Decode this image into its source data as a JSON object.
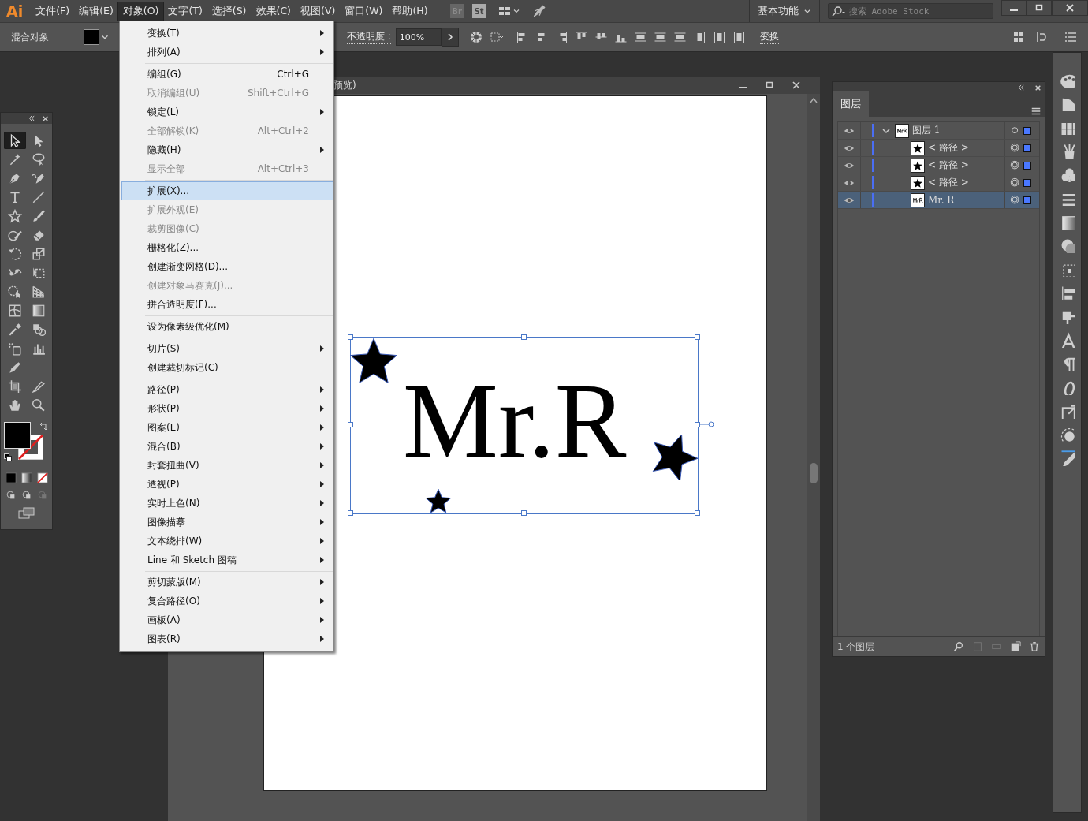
{
  "app": {
    "logo": "Ai",
    "menus": [
      {
        "label": "文件(F)",
        "selected": false
      },
      {
        "label": "编辑(E)",
        "selected": false
      },
      {
        "label": "对象(O)",
        "selected": true
      },
      {
        "label": "文字(T)",
        "selected": false
      },
      {
        "label": "选择(S)",
        "selected": false
      },
      {
        "label": "效果(C)",
        "selected": false
      },
      {
        "label": "视图(V)",
        "selected": false
      },
      {
        "label": "窗口(W)",
        "selected": false
      },
      {
        "label": "帮助(H)",
        "selected": false
      }
    ],
    "badges": [
      "Br",
      "St"
    ],
    "workspace": "基本功能",
    "search": {
      "placeholder": "搜索 Adobe Stock"
    }
  },
  "control_bar": {
    "selection_label": "混合对象",
    "opacity_label": "不透明度 :",
    "opacity_value": "100%",
    "transform_link": "变换"
  },
  "object_menu": [
    [
      {
        "label": "变换(T)",
        "submenu": true,
        "disabled": false,
        "selected": false
      },
      {
        "label": "排列(A)",
        "submenu": true,
        "disabled": false,
        "selected": false
      }
    ],
    [
      {
        "label": "编组(G)",
        "shortcut": "Ctrl+G",
        "submenu": false,
        "disabled": false,
        "selected": false
      },
      {
        "label": "取消编组(U)",
        "shortcut": "Shift+Ctrl+G",
        "submenu": false,
        "disabled": true,
        "selected": false
      },
      {
        "label": "锁定(L)",
        "submenu": true,
        "disabled": false,
        "selected": false
      },
      {
        "label": "全部解锁(K)",
        "shortcut": "Alt+Ctrl+2",
        "submenu": false,
        "disabled": true,
        "selected": false
      },
      {
        "label": "隐藏(H)",
        "submenu": true,
        "disabled": false,
        "selected": false
      },
      {
        "label": "显示全部",
        "shortcut": "Alt+Ctrl+3",
        "submenu": false,
        "disabled": true,
        "selected": false
      }
    ],
    [
      {
        "label": "扩展(X)...",
        "submenu": false,
        "disabled": false,
        "selected": true
      },
      {
        "label": "扩展外观(E)",
        "submenu": false,
        "disabled": true,
        "selected": false
      },
      {
        "label": "裁剪图像(C)",
        "submenu": false,
        "disabled": true,
        "selected": false
      },
      {
        "label": "栅格化(Z)...",
        "submenu": false,
        "disabled": false,
        "selected": false
      },
      {
        "label": "创建渐变网格(D)...",
        "submenu": false,
        "disabled": false,
        "selected": false
      },
      {
        "label": "创建对象马赛克(J)...",
        "submenu": false,
        "disabled": true,
        "selected": false
      },
      {
        "label": "拼合透明度(F)...",
        "submenu": false,
        "disabled": false,
        "selected": false
      }
    ],
    [
      {
        "label": "设为像素级优化(M)",
        "submenu": false,
        "disabled": false,
        "selected": false
      }
    ],
    [
      {
        "label": "切片(S)",
        "submenu": true,
        "disabled": false,
        "selected": false
      },
      {
        "label": "创建裁切标记(C)",
        "submenu": false,
        "disabled": false,
        "selected": false
      }
    ],
    [
      {
        "label": "路径(P)",
        "submenu": true,
        "disabled": false,
        "selected": false
      },
      {
        "label": "形状(P)",
        "submenu": true,
        "disabled": false,
        "selected": false
      },
      {
        "label": "图案(E)",
        "submenu": true,
        "disabled": false,
        "selected": false
      },
      {
        "label": "混合(B)",
        "submenu": true,
        "disabled": false,
        "selected": false
      },
      {
        "label": "封套扭曲(V)",
        "submenu": true,
        "disabled": false,
        "selected": false
      },
      {
        "label": "透视(P)",
        "submenu": true,
        "disabled": false,
        "selected": false
      },
      {
        "label": "实时上色(N)",
        "submenu": true,
        "disabled": false,
        "selected": false
      },
      {
        "label": "图像描摹",
        "submenu": true,
        "disabled": false,
        "selected": false
      },
      {
        "label": "文本绕排(W)",
        "submenu": true,
        "disabled": false,
        "selected": false
      },
      {
        "label": "Line 和 Sketch 图稿",
        "submenu": true,
        "disabled": false,
        "selected": false
      }
    ],
    [
      {
        "label": "剪切蒙版(M)",
        "submenu": true,
        "disabled": false,
        "selected": false
      },
      {
        "label": "复合路径(O)",
        "submenu": true,
        "disabled": false,
        "selected": false
      },
      {
        "label": "画板(A)",
        "submenu": true,
        "disabled": false,
        "selected": false
      },
      {
        "label": "图表(R)",
        "submenu": true,
        "disabled": false,
        "selected": false
      }
    ]
  ],
  "tools": [
    {
      "kind": "selection",
      "selected": true
    },
    {
      "kind": "direct",
      "selected": false
    },
    {
      "kind": "wand",
      "selected": false
    },
    {
      "kind": "lasso",
      "selected": false
    },
    {
      "kind": "pen",
      "selected": false
    },
    {
      "kind": "curvature",
      "selected": false
    },
    {
      "kind": "type",
      "selected": false
    },
    {
      "kind": "line",
      "selected": false
    },
    {
      "kind": "star",
      "selected": false
    },
    {
      "kind": "brush",
      "selected": false
    },
    {
      "kind": "shaper",
      "selected": false
    },
    {
      "kind": "eraser",
      "selected": false
    },
    {
      "kind": "rotate",
      "selected": false
    },
    {
      "kind": "scale",
      "selected": false
    },
    {
      "kind": "puppet",
      "selected": false
    },
    {
      "kind": "freetransform",
      "selected": false
    },
    {
      "kind": "shapebuilder",
      "selected": false
    },
    {
      "kind": "perspective",
      "selected": false
    },
    {
      "kind": "mesh",
      "selected": false
    },
    {
      "kind": "gradient",
      "selected": false
    },
    {
      "kind": "eyedropper",
      "selected": false
    },
    {
      "kind": "blend",
      "selected": false
    },
    {
      "kind": "sprayer",
      "selected": false
    },
    {
      "kind": "graph",
      "selected": false
    },
    {
      "kind": "pencil",
      "selected": false
    },
    {
      "kind": "artboard",
      "selected": false
    },
    {
      "kind": "knife",
      "selected": false
    },
    {
      "kind": "hand",
      "selected": false
    },
    {
      "kind": "zoom",
      "selected": false
    }
  ],
  "document": {
    "title": "预览)",
    "artwork_text": "Mr.R"
  },
  "layers_panel": {
    "tab": "图层",
    "layers": [
      {
        "name": "图层 1",
        "expanded": true,
        "selected": false,
        "kind": "text",
        "children": [
          {
            "name": "< 路径 >",
            "selected": false,
            "kind": "star"
          },
          {
            "name": "< 路径 >",
            "selected": false,
            "kind": "star"
          },
          {
            "name": "< 路径 >",
            "selected": false,
            "kind": "star"
          },
          {
            "name": "Mr. R",
            "selected": true,
            "kind": "text"
          }
        ]
      }
    ],
    "footer": "1 个图层"
  }
}
